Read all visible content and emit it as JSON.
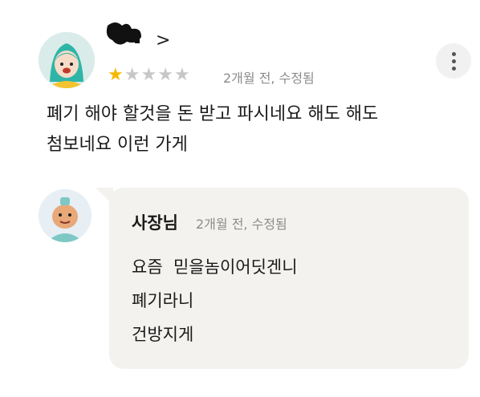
{
  "review": {
    "reviewer_name_suffix": ">",
    "rating": 1,
    "rating_max": 5,
    "meta": "2개월 전, 수정됨",
    "body_lines": [
      "폐기 해야 할것을 돈 받고 파시네요 해도 해도",
      "첨보네요 이런 가게"
    ]
  },
  "reply": {
    "owner_name": "사장님",
    "meta": "2개월 전, 수정됨",
    "body_lines": [
      "요즘  믿을놈이어딧겐니",
      "폐기라니",
      "건방지게"
    ]
  },
  "icons": {
    "more": "more-vertical-icon",
    "star": "star-icon"
  },
  "colors": {
    "star_filled": "#f5b800",
    "star_empty": "#c7c7c7",
    "reply_background": "#f3f2ef",
    "meta_text": "#8c8c8c"
  }
}
